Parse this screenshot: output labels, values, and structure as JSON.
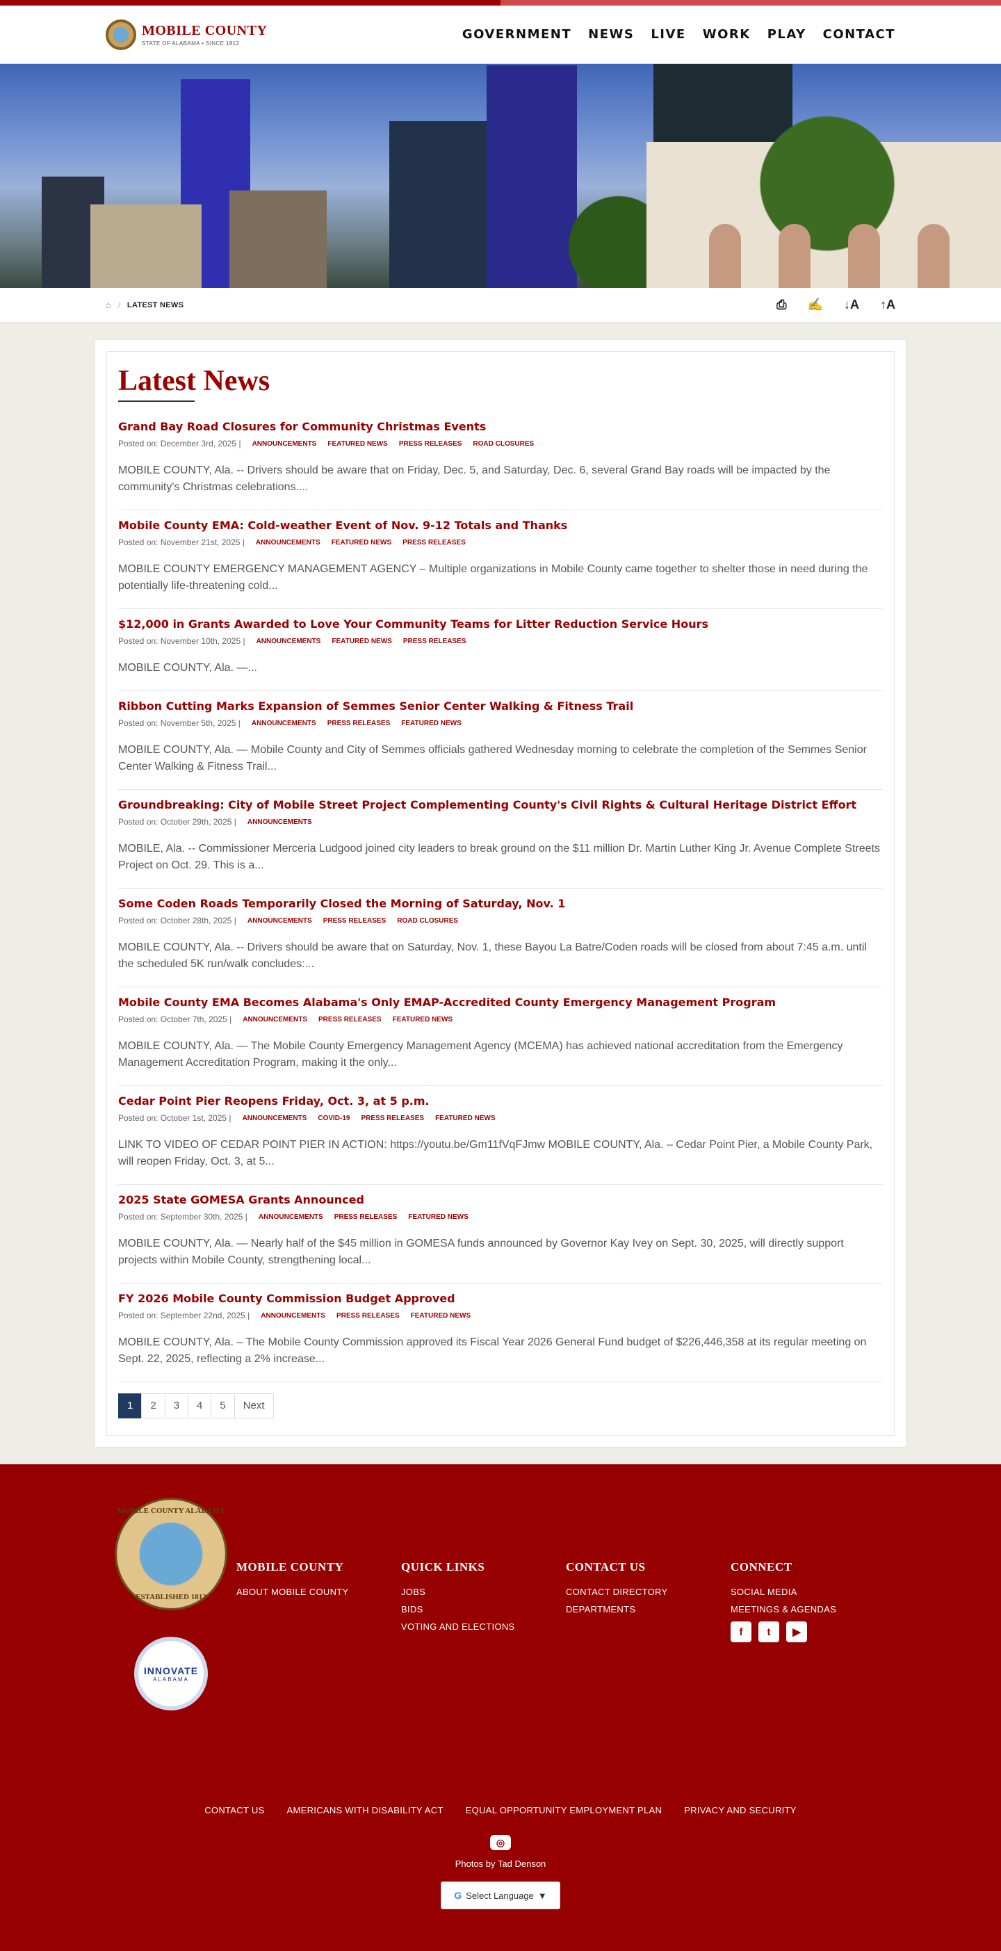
{
  "header": {
    "name": "MOBILE COUNTY",
    "tagline": "STATE OF ALABAMA • SINCE 1812",
    "nav": [
      "GOVERNMENT",
      "NEWS",
      "LIVE",
      "WORK",
      "PLAY",
      "CONTACT"
    ]
  },
  "breadcrumb": {
    "current": "LATEST NEWS"
  },
  "tools": [
    "print-icon",
    "sign-icon",
    "decrease-font-icon",
    "increase-font-icon"
  ],
  "page_title": "Latest News",
  "posts": [
    {
      "title": "Grand Bay Road Closures for Community Christmas Events",
      "date": "Posted on: December 3rd, 2025 |",
      "tags": [
        "ANNOUNCEMENTS",
        "FEATURED NEWS",
        "PRESS RELEASES",
        "ROAD CLOSURES"
      ],
      "excerpt": "  MOBILE COUNTY, Ala. -- Drivers should be aware that on Friday, Dec. 5, and Saturday, Dec. 6, several Grand Bay roads will be impacted by the community's Christmas celebrations...."
    },
    {
      "title": "Mobile County EMA: Cold-weather Event of Nov. 9-12 Totals and Thanks",
      "date": "Posted on: November 21st, 2025 |",
      "tags": [
        "ANNOUNCEMENTS",
        "FEATURED NEWS",
        "PRESS RELEASES"
      ],
      "excerpt": "   MOBILE COUNTY EMERGENCY MANAGEMENT AGENCY – Multiple organizations in Mobile County came together to shelter those in need during the potentially life-threatening cold..."
    },
    {
      "title": "$12,000 in Grants Awarded to Love Your Community Teams for Litter Reduction Service Hours",
      "date": "Posted on: November 10th, 2025 |",
      "tags": [
        "ANNOUNCEMENTS",
        "FEATURED NEWS",
        "PRESS RELEASES"
      ],
      "excerpt": "MOBILE COUNTY, Ala. —..."
    },
    {
      "title": "Ribbon Cutting Marks Expansion of Semmes Senior Center Walking & Fitness Trail",
      "date": "Posted on: November 5th, 2025 |",
      "tags": [
        "ANNOUNCEMENTS",
        "PRESS RELEASES",
        "FEATURED NEWS"
      ],
      "excerpt": "  MOBILE COUNTY, Ala. — Mobile County and City of Semmes officials gathered Wednesday morning to celebrate the completion of the Semmes Senior Center Walking & Fitness Trail..."
    },
    {
      "title": "Groundbreaking: City of Mobile Street Project Complementing County's Civil Rights & Cultural Heritage District Effort",
      "date": "Posted on: October 29th, 2025 |",
      "tags": [
        "ANNOUNCEMENTS"
      ],
      "excerpt": "  MOBILE, Ala. -- Commissioner Merceria Ludgood joined city leaders to break ground on the $11 million Dr. Martin Luther King Jr. Avenue Complete Streets Project on Oct. 29. This is a..."
    },
    {
      "title": "Some Coden Roads Temporarily Closed the Morning of Saturday, Nov. 1",
      "date": "Posted on: October 28th, 2025 |",
      "tags": [
        "ANNOUNCEMENTS",
        "PRESS RELEASES",
        "ROAD CLOSURES"
      ],
      "excerpt": "  MOBILE COUNTY, Ala. -- Drivers should be aware that on Saturday, Nov. 1, these Bayou La Batre/Coden roads will be closed from about 7:45 a.m. until the scheduled 5K run/walk concludes:..."
    },
    {
      "title": "Mobile County EMA Becomes Alabama's Only EMAP-Accredited County Emergency Management Program",
      "date": "Posted on: October 7th, 2025 |",
      "tags": [
        "ANNOUNCEMENTS",
        "PRESS RELEASES",
        "FEATURED NEWS"
      ],
      "excerpt": "  MOBILE COUNTY, Ala. — The Mobile County Emergency Management Agency (MCEMA) has achieved national accreditation from the Emergency Management Accreditation Program, making it the only..."
    },
    {
      "title": "Cedar Point Pier Reopens Friday, Oct. 3, at 5 p.m.",
      "date": "Posted on: October 1st, 2025 |",
      "tags": [
        "ANNOUNCEMENTS",
        "COVID-19",
        "PRESS RELEASES",
        "FEATURED NEWS"
      ],
      "excerpt": "  LINK TO VIDEO OF CEDAR POINT PIER IN ACTION: https://youtu.be/Gm11fVqFJmw   MOBILE COUNTY, Ala. – Cedar Point Pier, a Mobile County Park, will reopen Friday, Oct. 3, at 5..."
    },
    {
      "title": "2025 State GOMESA Grants Announced",
      "date": "Posted on: September 30th, 2025 |",
      "tags": [
        "ANNOUNCEMENTS",
        "PRESS RELEASES",
        "FEATURED NEWS"
      ],
      "excerpt": "MOBILE COUNTY, Ala. — Nearly half of the $45 million in GOMESA funds announced by Governor Kay Ivey on Sept. 30, 2025, will directly support projects within Mobile County, strengthening local..."
    },
    {
      "title": "FY 2026 Mobile County Commission Budget Approved",
      "date": "Posted on: September 22nd, 2025 |",
      "tags": [
        "ANNOUNCEMENTS",
        "PRESS RELEASES",
        "FEATURED NEWS"
      ],
      "excerpt": "  MOBILE COUNTY, Ala. – The Mobile County Commission approved its Fiscal Year 2026 General Fund budget of $226,446,358 at its regular meeting on Sept. 22, 2025, reflecting a 2% increase..."
    }
  ],
  "pagination": {
    "pages": [
      "1",
      "2",
      "3",
      "4",
      "5"
    ],
    "next": "Next",
    "active": "1"
  },
  "footer": {
    "seal_top": "MOBILE COUNTY ALABAMA",
    "seal_bottom": "ESTABLISHED 1812",
    "innovate_word": "INNOVATE",
    "innovate_sub": "ALABAMA",
    "cols": [
      {
        "heading": "MOBILE COUNTY",
        "links": [
          "ABOUT MOBILE COUNTY"
        ]
      },
      {
        "heading": "QUICK LINKS",
        "links": [
          "JOBS",
          "BIDS",
          "VOTING AND ELECTIONS"
        ]
      },
      {
        "heading": "CONTACT US",
        "links": [
          "CONTACT DIRECTORY",
          "DEPARTMENTS"
        ]
      },
      {
        "heading": "CONNECT",
        "links": [
          "SOCIAL MEDIA",
          "MEETINGS & AGENDAS"
        ]
      }
    ],
    "social": [
      "facebook-icon",
      "twitter-icon",
      "youtube-icon"
    ],
    "bottom_links": [
      "CONTACT US",
      "AMERICANS WITH DISABILITY ACT",
      "EQUAL OPPORTUNITY EMPLOYMENT PLAN",
      "PRIVACY AND SECURITY"
    ],
    "credit": "Photos by Tad Denson",
    "translate_label": "Select Language",
    "translate_arrow": "▼"
  },
  "colors": {
    "brand_red": "#9b0000",
    "footer_red": "#960000",
    "pagination_active": "#1f3a5f"
  }
}
